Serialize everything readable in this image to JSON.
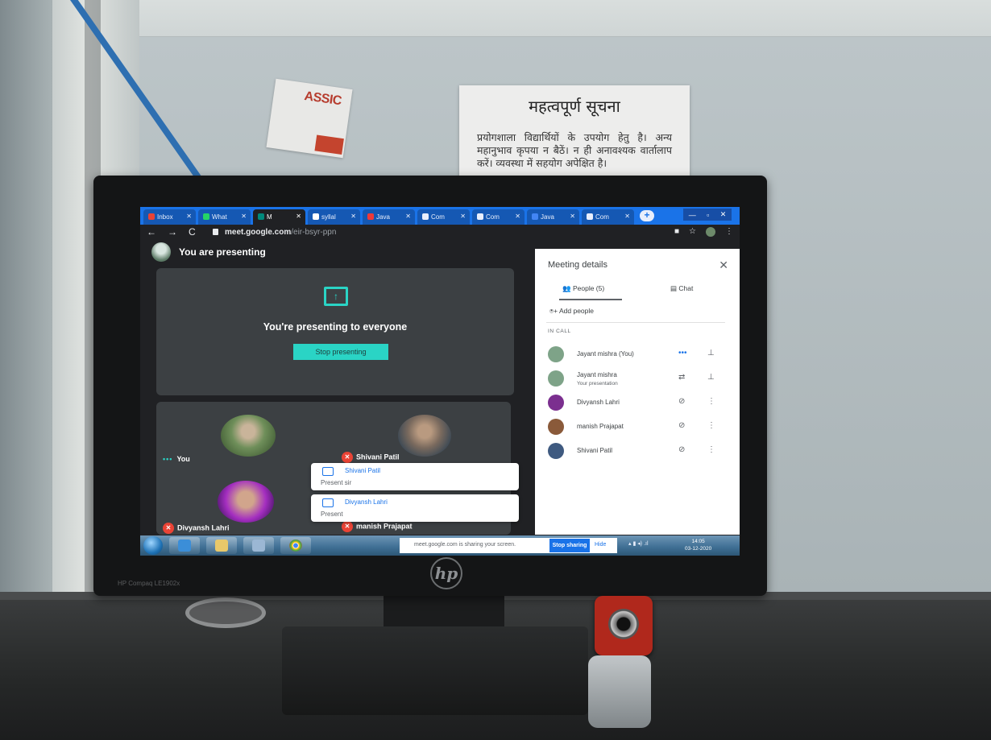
{
  "room": {
    "sticker_text": "ASSIC",
    "notice_title": "महत्वपूर्ण सूचना",
    "notice_body": "प्रयोगशाला विद्यार्थियों के उपयोग हेतु है। अन्य महानुभाव कृपया न बैठें। न ही अनावश्यक वार्तालाप करें। व्यवस्था में सहयोग अपेक्षित है।",
    "monitor_model": "HP Compaq LE1902x",
    "monitor_logo": "hp"
  },
  "browser": {
    "tabs": [
      {
        "label": "Inbox",
        "icon": "gmail-icon",
        "color": "#ea4335"
      },
      {
        "label": "What",
        "icon": "whatsapp-icon",
        "color": "#25d366"
      },
      {
        "label": "M",
        "icon": "meet-icon",
        "color": "#00897b",
        "active": true
      },
      {
        "label": "syllal",
        "icon": "chrome-icon",
        "color": "#ffffff"
      },
      {
        "label": "Java",
        "icon": "vivaldi-icon",
        "color": "#ef3939"
      },
      {
        "label": "Com",
        "icon": "t-icon",
        "color": "#e8eefc"
      },
      {
        "label": "Com",
        "icon": "t-icon",
        "color": "#e8eefc"
      },
      {
        "label": "Java",
        "icon": "doc-icon",
        "color": "#4285f4"
      },
      {
        "label": "Com",
        "icon": "t-icon",
        "color": "#e8eefc"
      }
    ],
    "url_domain": "meet.google.com",
    "url_path": "/eir-bsyr-ppn"
  },
  "meet": {
    "presenting_title": "You are presenting",
    "presenting_message": "You're presenting to everyone",
    "stop_presenting_label": "Stop presenting",
    "tiles": [
      {
        "name": "You",
        "speaking": "•••"
      },
      {
        "name": "Shivani Patil",
        "muted": true
      },
      {
        "name": "Divyansh Lahri",
        "muted": true
      },
      {
        "name": "manish Prajapat",
        "muted": true
      }
    ],
    "chat_toasts": [
      {
        "name": "Shivani Patil",
        "message": "Present sir"
      },
      {
        "name": "Divyansh Lahri",
        "message": "Present"
      }
    ]
  },
  "panel": {
    "title": "Meeting details",
    "people_tab": "People (5)",
    "chat_tab": "Chat",
    "add_people": "Add people",
    "in_call_label": "IN CALL",
    "people": [
      {
        "name": "Jayant mishra (You)",
        "sub": "",
        "status_icon": "speaking-dots-icon",
        "action_icon": "pin-icon",
        "avatar": "#7ea388"
      },
      {
        "name": "Jayant mishra",
        "sub": "Your presentation",
        "status_icon": "present-icon",
        "action_icon": "pin-icon",
        "avatar": "#7ea388"
      },
      {
        "name": "Divyansh Lahri",
        "sub": "",
        "status_icon": "mic-off-icon",
        "action_icon": "more-icon",
        "avatar": "#7b2f8f"
      },
      {
        "name": "manish Prajapat",
        "sub": "",
        "status_icon": "mic-off-icon",
        "action_icon": "more-icon",
        "avatar": "#8a5a3a"
      },
      {
        "name": "Shivani Patil",
        "sub": "",
        "status_icon": "mic-off-icon",
        "action_icon": "more-icon",
        "avatar": "#3f5a80"
      }
    ]
  },
  "taskbar": {
    "sharing_text": "meet.google.com is sharing your screen.",
    "stop_sharing_label": "Stop sharing",
    "hide_label": "Hide",
    "time": "14:05",
    "date": "03-12-2020"
  }
}
